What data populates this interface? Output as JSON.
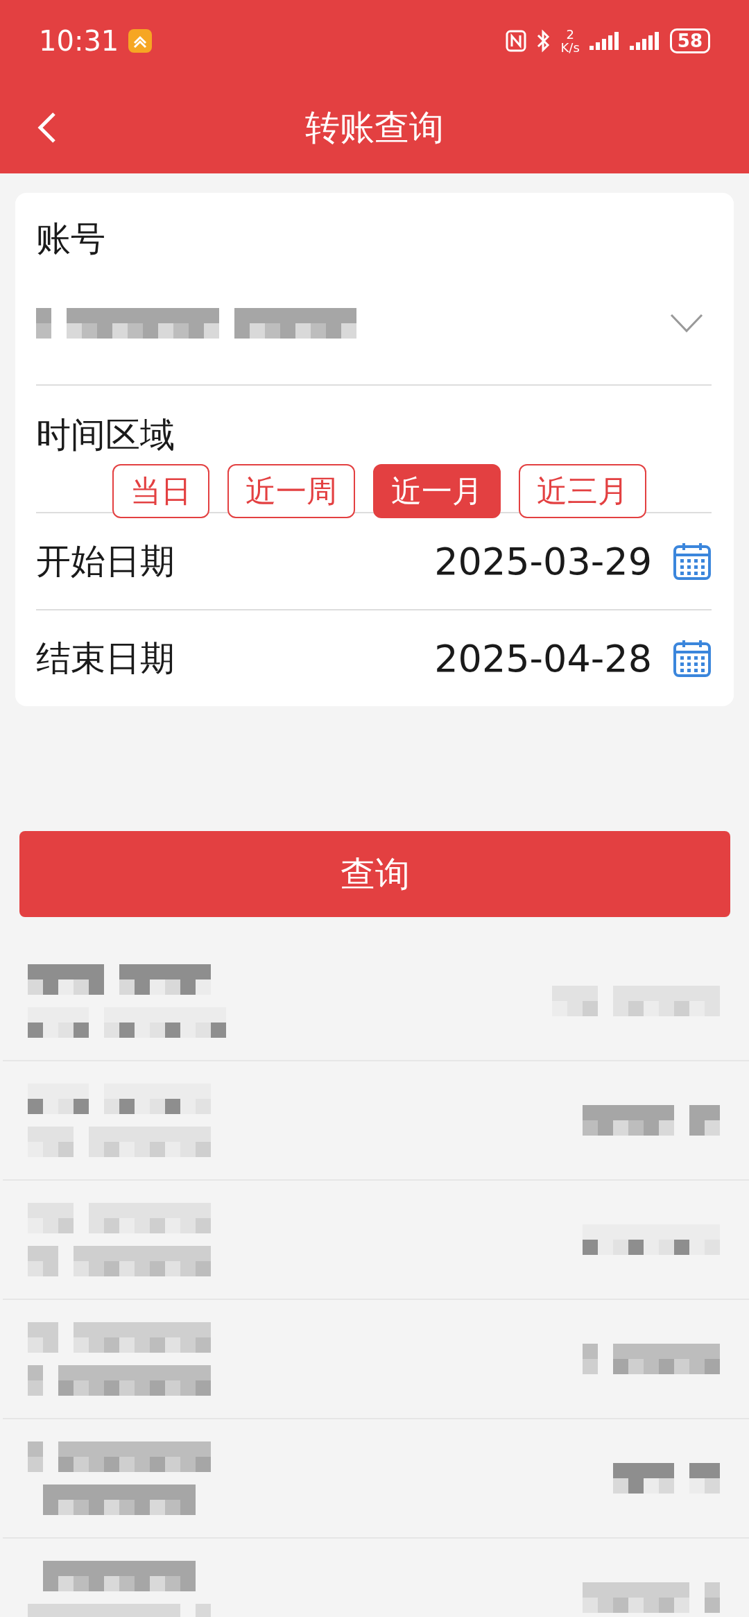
{
  "status_bar": {
    "time": "10:31",
    "speed_value": "2",
    "speed_unit": "K/s",
    "battery": "58"
  },
  "header": {
    "title": "转账查询"
  },
  "form": {
    "account_label": "账号",
    "account_value": {
      "kind": "pixelated"
    },
    "period_label": "时间区域",
    "periods": [
      {
        "label": "当日",
        "selected": false
      },
      {
        "label": "近一周",
        "selected": false
      },
      {
        "label": "近一月",
        "selected": true
      },
      {
        "label": "近三月",
        "selected": false
      }
    ],
    "start": {
      "label": "开始日期",
      "value": "2025-03-29"
    },
    "end": {
      "label": "结束日期",
      "value": "2025-04-28"
    }
  },
  "query_button": "查询",
  "records": [
    {
      "kind": "pixelated"
    },
    {
      "kind": "pixelated"
    },
    {
      "kind": "pixelated"
    },
    {
      "kind": "pixelated"
    },
    {
      "kind": "pixelated"
    },
    {
      "kind": "pixelated"
    }
  ]
}
